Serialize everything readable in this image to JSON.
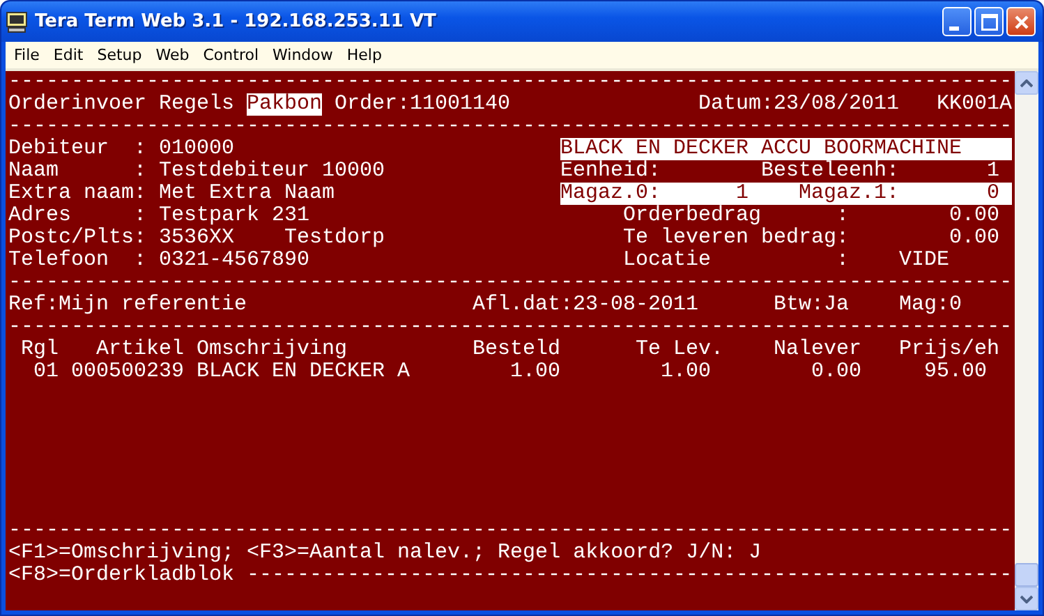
{
  "window": {
    "title": "Tera Term Web 3.1 - 192.168.253.11 VT"
  },
  "menu": [
    "File",
    "Edit",
    "Setup",
    "Web",
    "Control",
    "Window",
    "Help"
  ],
  "screen": {
    "lines": [
      [
        {
          "text": "--------------------------------------------------------------------------------"
        }
      ],
      [
        {
          "text": "Orderinvoer"
        },
        {
          "text": "Regels"
        },
        {
          "text": "Pakbon",
          "inverse": true
        },
        {
          "text": "Order:11001140"
        },
        {
          "text": "Datum:23/08/2011"
        },
        {
          "text": "KK001A"
        }
      ],
      [
        {
          "text": "--------------------------------------------------------------------------------"
        }
      ],
      [
        {
          "text": "Debiteur  :"
        },
        {
          "text": "010000"
        },
        {
          "kind": "bar",
          "parts": [
            "BLACK EN DECKER ACCU BOORMACHINE"
          ]
        }
      ],
      [
        {
          "text": "Naam      :"
        },
        {
          "text": "Testdebiteur 10000"
        },
        {
          "text": "Eenheid:"
        },
        {
          "text": "Besteleenh:"
        },
        {
          "text": "1"
        }
      ],
      [
        {
          "text": "Extra naam:"
        },
        {
          "text": "Met Extra Naam"
        },
        {
          "kind": "bar",
          "parts": [
            "Magaz.0:",
            "1",
            "Magaz.1:",
            "0"
          ]
        }
      ],
      [
        {
          "text": "Adres     :"
        },
        {
          "text": "Testpark 231"
        },
        {
          "text": "Orderbedrag"
        },
        {
          "text": ":"
        },
        {
          "text": "0.00"
        }
      ],
      [
        {
          "text": "Postc/Plts:"
        },
        {
          "text": "3536XX"
        },
        {
          "text": "Testdorp"
        },
        {
          "text": "Te leveren bedrag:"
        },
        {
          "text": "0.00"
        }
      ],
      [
        {
          "text": "Telefoon  :"
        },
        {
          "text": "0321-4567890"
        },
        {
          "text": "Locatie"
        },
        {
          "text": ":"
        },
        {
          "text": "VIDE"
        }
      ],
      [
        {
          "text": "--------------------------------------------------------------------------------"
        }
      ],
      [
        {
          "text": "Ref:Mijn referentie"
        },
        {
          "text": "Afl.dat:23-08-2011"
        },
        {
          "text": "Btw:Ja"
        },
        {
          "text": "Mag:0"
        }
      ],
      [
        {
          "text": "--------------------------------------------------------------------------------"
        }
      ],
      [
        {
          "text": "Rgl"
        },
        {
          "text": "Artikel"
        },
        {
          "text": "Omschrijving"
        },
        {
          "text": "Besteld"
        },
        {
          "text": "Te Lev."
        },
        {
          "text": "Nalever"
        },
        {
          "text": "Prijs/eh"
        }
      ],
      [
        {
          "text": "01"
        },
        {
          "text": "000500239"
        },
        {
          "text": "BLACK EN DECKER A"
        },
        {
          "text": "1.00"
        },
        {
          "text": "1.00"
        },
        {
          "text": "0.00"
        },
        {
          "text": "95.00"
        }
      ]
    ],
    "footer_lines": [
      [
        {
          "text": "--------------------------------------------------------------------------------"
        }
      ],
      [
        {
          "text": "<F1>=Omschrijving; <F3>=Aantal nalev.; Regel akkoord? J/N: J"
        }
      ],
      [
        {
          "text": "<F8>=Orderkladblok"
        },
        {
          "text": "-------------------------------------------------------------"
        }
      ]
    ]
  }
}
